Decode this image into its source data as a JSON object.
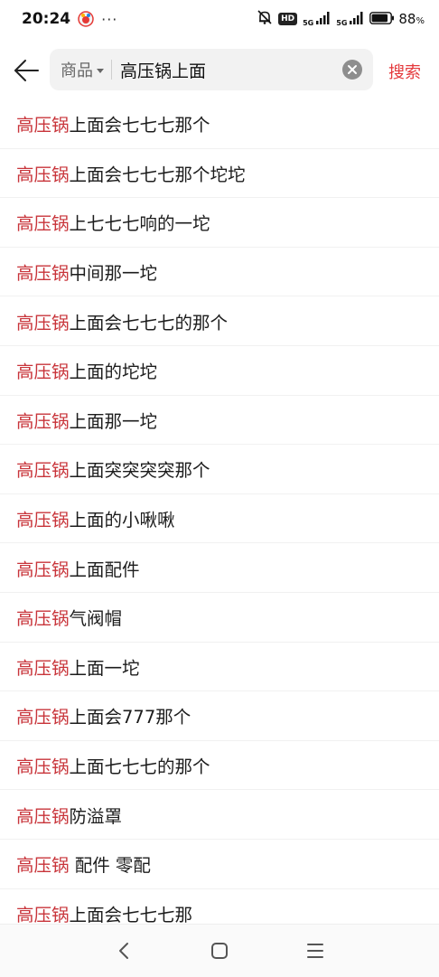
{
  "status_bar": {
    "time": "20:24",
    "more": "···",
    "hd": "HD",
    "net1": "5G",
    "net2": "5G",
    "battery_pct": "88",
    "battery_pct_sign": "%",
    "battery_level": 0.88
  },
  "search": {
    "scope_label": "商品",
    "query": "高压锅上面",
    "button_label": "搜索"
  },
  "suggestions": [
    {
      "keyword": "高压锅",
      "rest": "上面会七七七那个"
    },
    {
      "keyword": "高压锅",
      "rest": "上面会七七七那个坨坨"
    },
    {
      "keyword": "高压锅",
      "rest": "上七七七响的一坨"
    },
    {
      "keyword": "高压锅",
      "rest": "中间那一坨"
    },
    {
      "keyword": "高压锅",
      "rest": "上面会七七七的那个"
    },
    {
      "keyword": "高压锅",
      "rest": "上面的坨坨"
    },
    {
      "keyword": "高压锅",
      "rest": "上面那一坨"
    },
    {
      "keyword": "高压锅",
      "rest": "上面突突突突那个"
    },
    {
      "keyword": "高压锅",
      "rest": "上面的小啾啾"
    },
    {
      "keyword": "高压锅",
      "rest": "上面配件"
    },
    {
      "keyword": "高压锅",
      "rest": "气阀帽"
    },
    {
      "keyword": "高压锅",
      "rest": "上面一坨"
    },
    {
      "keyword": "高压锅",
      "rest": "上面会777那个"
    },
    {
      "keyword": "高压锅",
      "rest": "上面七七七的那个"
    },
    {
      "keyword": "高压锅",
      "rest": "防溢罩"
    },
    {
      "keyword": "高压锅",
      "rest": " 配件 零配"
    },
    {
      "keyword": "高压锅",
      "rest": "上面会七七七那"
    }
  ],
  "colors": {
    "accent": "#e4393c",
    "keyword_highlight": "#c8343a",
    "search_bg": "#f2f2f2"
  },
  "icons": {
    "back": "back-arrow-icon",
    "clear": "clear-icon",
    "nav_back": "nav-back-icon",
    "nav_home": "nav-home-icon",
    "nav_menu": "nav-menu-icon"
  }
}
